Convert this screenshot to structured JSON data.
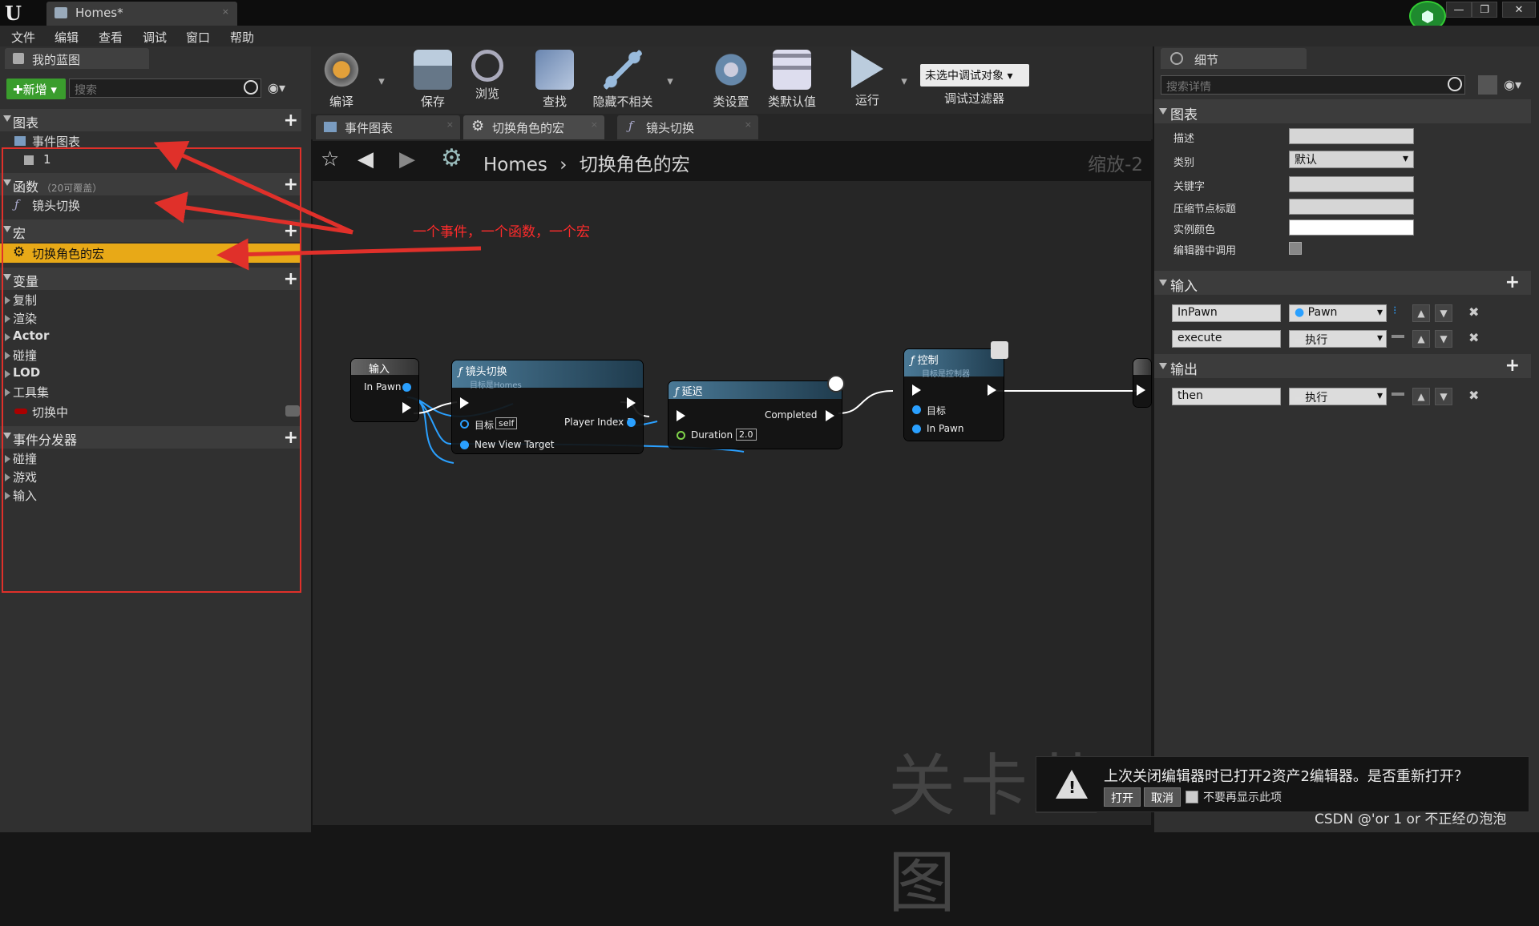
{
  "app": {
    "logo": "U",
    "doc_tab": "Homes*",
    "doc_tab_close": "×"
  },
  "window_buttons": {
    "minimize": "—",
    "restore": "❐",
    "close": "✕"
  },
  "menubar": [
    "文件",
    "编辑",
    "查看",
    "调试",
    "窗口",
    "帮助"
  ],
  "left_panel": {
    "tab": "我的蓝图",
    "tab_close": "×",
    "new_button": "✚新增 ▾",
    "search_placeholder": "搜索",
    "sections": {
      "graphs": "图表",
      "event_graph": "事件图表",
      "event_graph_child": "1",
      "functions": "函数",
      "functions_note": "（20可覆盖）",
      "function_item": "镜头切换",
      "macros": "宏",
      "macro_item": "切换角色的宏",
      "variables": "变量",
      "variable_categories": [
        "复制",
        "渲染",
        "Actor",
        "碰撞",
        "LOD",
        "工具集"
      ],
      "variable_item": "切换中",
      "dispatchers": "事件分发器",
      "dispatcher_categories": [
        "碰撞",
        "游戏",
        "输入"
      ]
    }
  },
  "toolbar": {
    "buttons": [
      "编译",
      "保存",
      "浏览",
      "查找",
      "隐藏不相关",
      "类设置",
      "类默认值",
      "运行"
    ],
    "debug_select": "未选中调试对象 ▾",
    "debug_filter": "调试过滤器"
  },
  "doc_tabs": [
    "事件图表",
    "切换角色的宏",
    "镜头切换"
  ],
  "graph": {
    "breadcrumb_root": "Homes",
    "breadcrumb_sep": "›",
    "breadcrumb_current": "切换角色的宏",
    "zoom": "缩放-2",
    "watermark": "关卡蓝图",
    "annotation": "一个事件，一个函数，一个宏",
    "nodes": {
      "input": {
        "title": "输入",
        "pin": "In Pawn"
      },
      "camera_switch": {
        "title": "镜头切换",
        "subtitle": "目标是Homes",
        "target": "目标",
        "self": "self",
        "player_index": "Player Index 1",
        "new_view_target": "New View Target"
      },
      "delay": {
        "title": "延迟",
        "completed": "Completed",
        "duration": "Duration",
        "duration_value": "2.0"
      },
      "possess": {
        "title": "控制",
        "subtitle": "目标是控制器",
        "target": "目标",
        "in_pawn": "In Pawn"
      }
    }
  },
  "notification": {
    "message": "上次关闭编辑器时已打开2资产2编辑器。是否重新打开？",
    "open": "打开",
    "cancel": "取消",
    "dont_show": "不要再显示此项"
  },
  "credit": "CSDN @'or 1 or 不正经の泡泡",
  "right_panel": {
    "tab": "细节",
    "tab_close": "×",
    "search_placeholder": "搜索详情",
    "graph_section": "图表",
    "props": [
      "描述",
      "类别",
      "关键字",
      "压缩节点标题",
      "实例颜色",
      "编辑器中调用"
    ],
    "category_value": "默认",
    "inputs_section": "输入",
    "inputs": [
      {
        "name": "InPawn",
        "type": "Pawn"
      },
      {
        "name": "execute",
        "type": "执行"
      }
    ],
    "outputs_section": "输出",
    "outputs": [
      {
        "name": "then",
        "type": "执行"
      }
    ]
  },
  "colors": {
    "accent_macro": "#e8a917",
    "annotation_red": "#e0302a",
    "new_button": "#3a9d2d",
    "pin_blue": "#2aa0ff"
  }
}
